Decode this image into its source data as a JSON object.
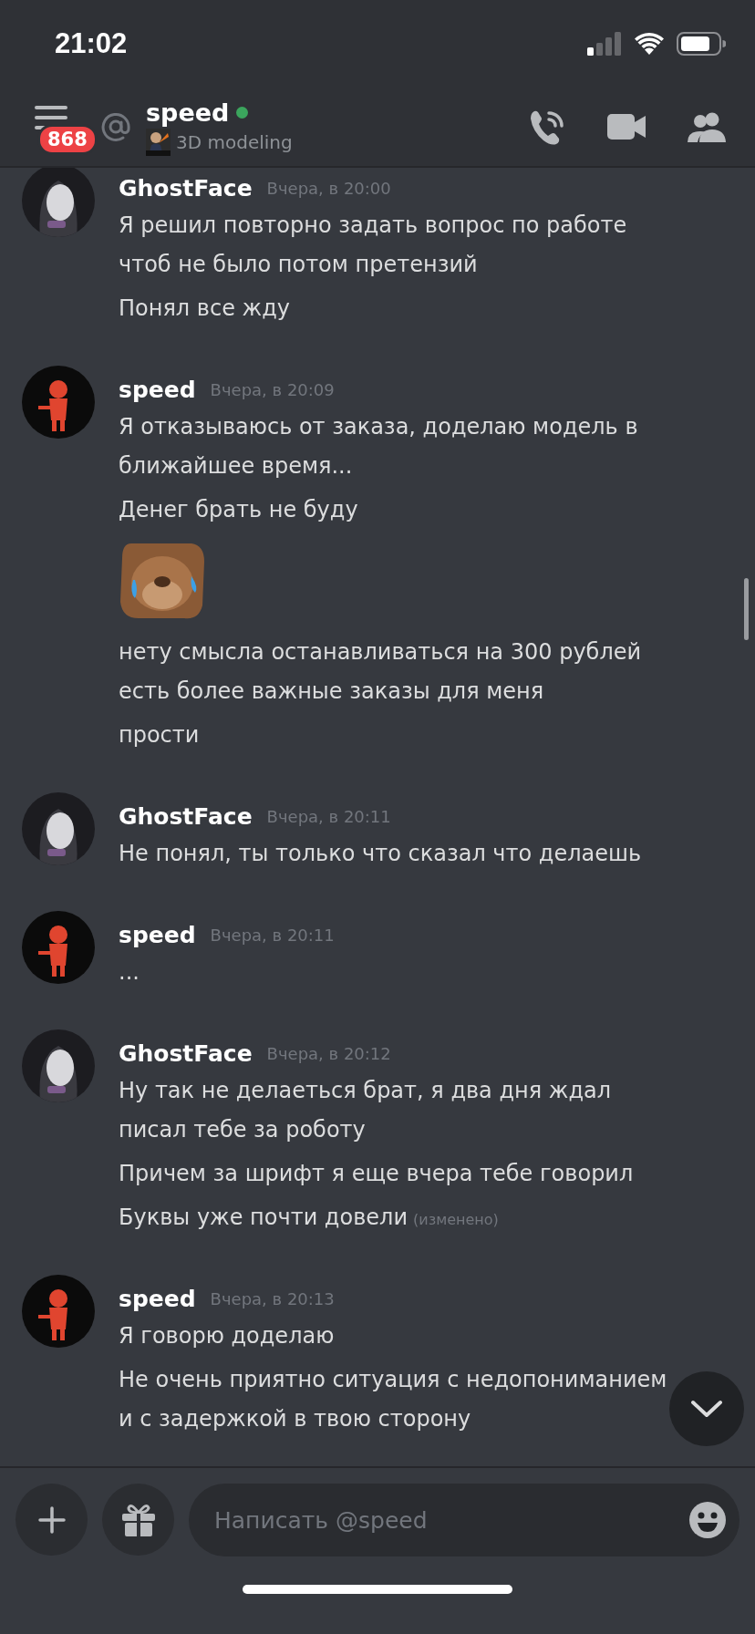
{
  "status_bar": {
    "time": "21:02"
  },
  "header": {
    "unread_badge": "868",
    "channel_name": "speed",
    "online": true,
    "activity": "3D modeling"
  },
  "messages": [
    {
      "author": "GhostFace",
      "timestamp": "Вчера, в 20:00",
      "items": [
        {
          "kind": "text",
          "text": "Я решил повторно задать вопрос по работе чтоб не было потом претензий"
        },
        {
          "kind": "text",
          "text": "Понял все жду"
        }
      ]
    },
    {
      "author": "speed",
      "timestamp": "Вчера, в 20:09",
      "items": [
        {
          "kind": "text",
          "text": "Я отказываюсь от заказа, доделаю модель в ближайшее время..."
        },
        {
          "kind": "text",
          "text": "Денег брать не буду"
        },
        {
          "kind": "sticker"
        },
        {
          "kind": "text",
          "text": "нету смысла останавливаться на 300 рублей есть более важные заказы для меня"
        },
        {
          "kind": "text",
          "text": "прости"
        }
      ]
    },
    {
      "author": "GhostFace",
      "timestamp": "Вчера, в 20:11",
      "items": [
        {
          "kind": "text",
          "text": "Не понял, ты только что сказал что делаешь"
        }
      ]
    },
    {
      "author": "speed",
      "timestamp": "Вчера, в 20:11",
      "items": [
        {
          "kind": "text",
          "text": "..."
        }
      ]
    },
    {
      "author": "GhostFace",
      "timestamp": "Вчера, в 20:12",
      "items": [
        {
          "kind": "text",
          "text": "Ну так не делаеться брат, я два дня ждал писал тебе за роботу"
        },
        {
          "kind": "text",
          "text": "Причем за шрифт я еще вчера тебе говорил"
        },
        {
          "kind": "text",
          "text": "Буквы уже почти довели",
          "edited_label": "(изменено)"
        }
      ]
    },
    {
      "author": "speed",
      "timestamp": "Вчера, в 20:13",
      "items": [
        {
          "kind": "text",
          "text": "Я говорю доделаю"
        },
        {
          "kind": "text",
          "text": "Не очень приятно ситуация с недопониманием и с задержкой в твою сторону"
        }
      ]
    }
  ],
  "composer": {
    "placeholder": "Написать @speed"
  }
}
